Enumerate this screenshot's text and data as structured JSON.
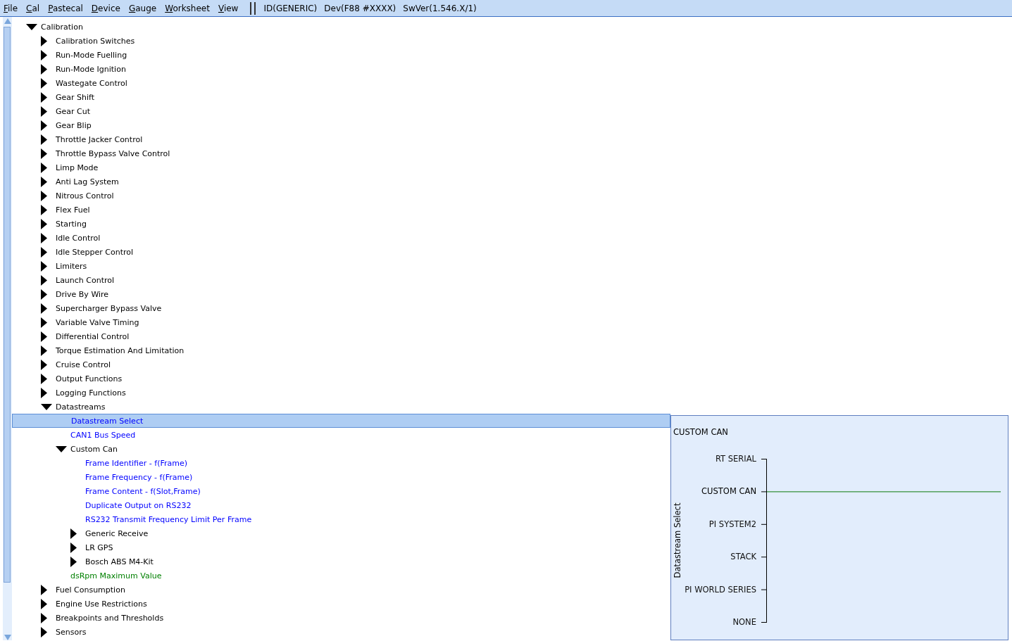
{
  "menu": [
    "File",
    "Cal",
    "Pastecal",
    "Device",
    "Gauge",
    "Worksheet",
    "View"
  ],
  "status": [
    "ID(GENERIC)",
    "Dev(F88 #XXXX)",
    "SwVer(1.546.X/1)"
  ],
  "tree": [
    {
      "label": "Calibration",
      "expanded": true,
      "selected": false,
      "children": [
        {
          "label": "Calibration Switches",
          "expanded": false,
          "selected": false
        },
        {
          "label": "Run-Mode Fuelling",
          "expanded": false,
          "selected": false
        },
        {
          "label": "Run-Mode Ignition",
          "expanded": false,
          "selected": false
        },
        {
          "label": "Wastegate Control",
          "expanded": false,
          "selected": false
        },
        {
          "label": "Gear Shift",
          "expanded": false,
          "selected": false
        },
        {
          "label": "Gear Cut",
          "expanded": false,
          "selected": false
        },
        {
          "label": "Gear Blip",
          "expanded": false,
          "selected": false
        },
        {
          "label": "Throttle Jacker Control",
          "expanded": false,
          "selected": false
        },
        {
          "label": "Throttle Bypass Valve Control",
          "expanded": false,
          "selected": false
        },
        {
          "label": "Limp Mode",
          "expanded": false,
          "selected": false
        },
        {
          "label": "Anti Lag System",
          "expanded": false,
          "selected": false
        },
        {
          "label": "Nitrous Control",
          "expanded": false,
          "selected": false
        },
        {
          "label": "Flex Fuel",
          "expanded": false,
          "selected": false
        },
        {
          "label": "Starting",
          "expanded": false,
          "selected": false
        },
        {
          "label": "Idle Control",
          "expanded": false,
          "selected": false
        },
        {
          "label": "Idle Stepper Control",
          "expanded": false,
          "selected": false
        },
        {
          "label": "Limiters",
          "expanded": false,
          "selected": false
        },
        {
          "label": "Launch Control",
          "expanded": false,
          "selected": false
        },
        {
          "label": "Drive By Wire",
          "expanded": false,
          "selected": false
        },
        {
          "label": "Supercharger Bypass Valve",
          "expanded": false,
          "selected": false
        },
        {
          "label": "Variable Valve Timing",
          "expanded": false,
          "selected": false
        },
        {
          "label": "Differential Control",
          "expanded": false,
          "selected": false
        },
        {
          "label": "Torque Estimation And Limitation",
          "expanded": false,
          "selected": false
        },
        {
          "label": "Cruise Control",
          "expanded": false,
          "selected": false
        },
        {
          "label": "Output Functions",
          "expanded": false,
          "selected": false
        },
        {
          "label": "Logging Functions",
          "expanded": false,
          "selected": false
        },
        {
          "label": "Datastreams",
          "expanded": true,
          "selected": false,
          "children": [
            {
              "label": "Datastream Select",
              "color": "#0000ff",
              "selected": true
            },
            {
              "label": "CAN1 Bus Speed",
              "color": "#0000ff",
              "selected": false
            },
            {
              "label": "Custom Can",
              "expanded": true,
              "selected": false,
              "children": [
                {
                  "label": "Frame Identifier - f(Frame)",
                  "color": "#0000ff",
                  "selected": false
                },
                {
                  "label": "Frame Frequency - f(Frame)",
                  "color": "#0000ff",
                  "selected": false
                },
                {
                  "label": "Frame Content - f(Slot,Frame)",
                  "color": "#0000ff",
                  "selected": false
                },
                {
                  "label": "Duplicate Output on RS232",
                  "color": "#0000ff",
                  "selected": false
                },
                {
                  "label": "RS232 Transmit Frequency Limit Per Frame",
                  "color": "#0000ff",
                  "selected": false
                },
                {
                  "label": "Generic Receive",
                  "expanded": false,
                  "selected": false
                },
                {
                  "label": "LR GPS",
                  "expanded": false,
                  "selected": false
                },
                {
                  "label": "Bosch ABS M4-Kit",
                  "expanded": false,
                  "selected": false
                }
              ]
            },
            {
              "label": "dsRpm Maximum Value",
              "color": "#008000",
              "selected": false
            }
          ]
        },
        {
          "label": "Fuel Consumption",
          "expanded": false,
          "selected": false
        },
        {
          "label": "Engine Use Restrictions",
          "expanded": false,
          "selected": false
        },
        {
          "label": "Breakpoints and Thresholds",
          "expanded": false,
          "selected": false
        },
        {
          "label": "Sensors",
          "expanded": false,
          "selected": false
        }
      ]
    }
  ],
  "panel": {
    "value": "CUSTOM CAN",
    "axis_label": "Datastream Select",
    "levels": [
      {
        "label": "RT SERIAL",
        "selected": false
      },
      {
        "label": "CUSTOM CAN",
        "selected": true
      },
      {
        "label": "PI SYSTEM2",
        "selected": false
      },
      {
        "label": "STACK",
        "selected": false
      },
      {
        "label": "PI WORLD SERIES",
        "selected": false
      },
      {
        "label": "NONE",
        "selected": false
      }
    ]
  }
}
